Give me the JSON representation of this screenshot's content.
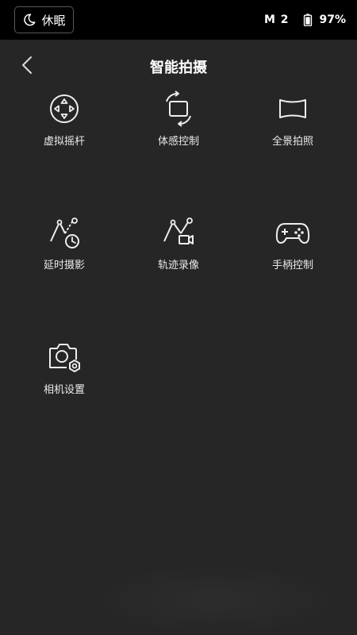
{
  "status_bar": {
    "sleep_label": "休眠",
    "mode": "M 2",
    "battery": "97%"
  },
  "header": {
    "title": "智能拍摄"
  },
  "tiles": [
    {
      "label": "虚拟摇杆",
      "icon": "joystick-icon"
    },
    {
      "label": "体感控制",
      "icon": "motion-control-icon"
    },
    {
      "label": "全景拍照",
      "icon": "panorama-icon"
    },
    {
      "label": "延时摄影",
      "icon": "timelapse-icon"
    },
    {
      "label": "轨迹录像",
      "icon": "trajectory-icon"
    },
    {
      "label": "手柄控制",
      "icon": "gamepad-icon"
    },
    {
      "label": "相机设置",
      "icon": "camera-settings-icon"
    }
  ],
  "colors": {
    "background": "#262626",
    "status_bar": "#000000",
    "text": "#eaeaea"
  }
}
